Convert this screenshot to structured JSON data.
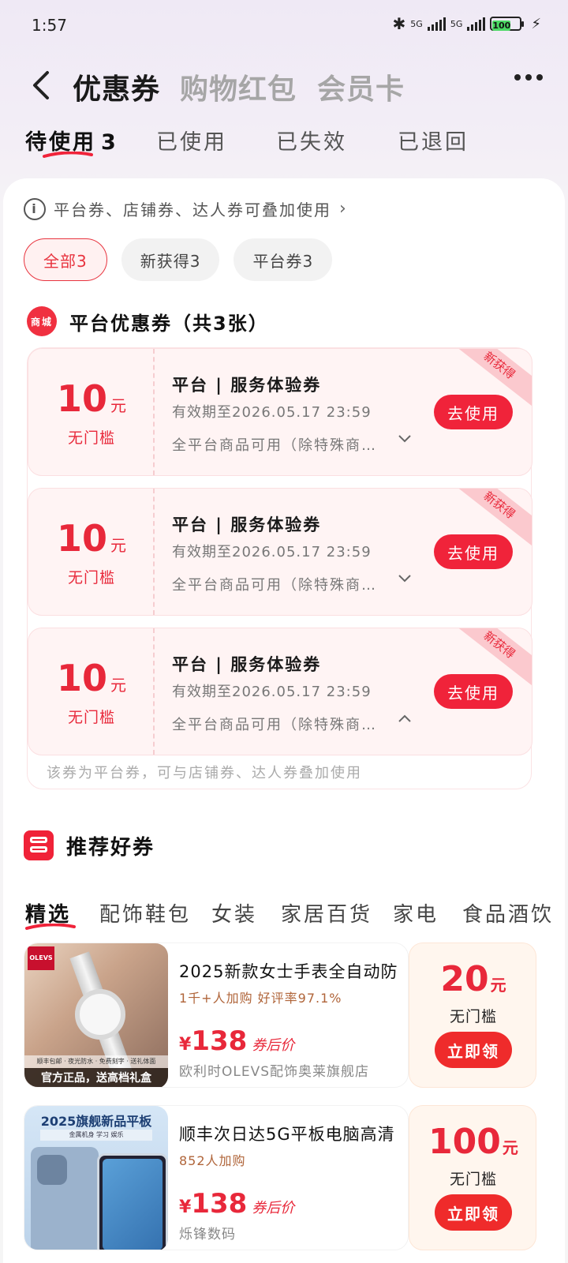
{
  "status_bar": {
    "time": "1:57",
    "network1": "5G",
    "network2": "5G",
    "battery": "100"
  },
  "header": {
    "tabs": [
      {
        "label": "优惠券",
        "active": true
      },
      {
        "label": "购物红包",
        "active": false
      },
      {
        "label": "会员卡",
        "active": false
      }
    ]
  },
  "status_tabs": [
    {
      "label": "待使用",
      "count": "3",
      "active": true
    },
    {
      "label": "已使用",
      "active": false
    },
    {
      "label": "已失效",
      "active": false
    },
    {
      "label": "已退回",
      "active": false
    }
  ],
  "tip": {
    "text": "平台券、店铺券、达人券可叠加使用"
  },
  "filters": [
    {
      "label": "全部3",
      "active": true
    },
    {
      "label": "新获得3",
      "active": false
    },
    {
      "label": "平台券3",
      "active": false
    }
  ],
  "section": {
    "icon_text": "商城",
    "title": "平台优惠券（共3张）"
  },
  "coupons": [
    {
      "amount": "10",
      "unit": "元",
      "condition": "无门槛",
      "name": "平台 | 服务体验券",
      "expiry": "有效期至2026.05.17 23:59",
      "scope": "全平台商品可用（除特殊商…",
      "toggle": "chevron-down",
      "button": "去使用",
      "ribbon": "新获得"
    },
    {
      "amount": "10",
      "unit": "元",
      "condition": "无门槛",
      "name": "平台 | 服务体验券",
      "expiry": "有效期至2026.05.17 23:59",
      "scope": "全平台商品可用（除特殊商…",
      "toggle": "chevron-down",
      "button": "去使用",
      "ribbon": "新获得"
    },
    {
      "amount": "10",
      "unit": "元",
      "condition": "无门槛",
      "name": "平台 | 服务体验券",
      "expiry": "有效期至2026.05.17 23:59",
      "scope": "全平台商品可用（除特殊商…",
      "toggle": "chevron-up",
      "button": "去使用",
      "ribbon": "新获得"
    }
  ],
  "group_note": "该券为平台券，可与店铺券、达人券叠加使用",
  "recommend": {
    "title": "推荐好券",
    "categories": [
      {
        "label": "精选",
        "active": true
      },
      {
        "label": "配饰鞋包",
        "active": false
      },
      {
        "label": "女装",
        "active": false
      },
      {
        "label": "家居百货",
        "active": false
      },
      {
        "label": "家电",
        "active": false
      },
      {
        "label": "食品酒饮",
        "active": false
      }
    ],
    "products": [
      {
        "title": "2025新款女士手表全自动防",
        "sales": "1千+人加购  好评率97.1%",
        "price_symbol": "¥",
        "price": "138",
        "price_note": "券后价",
        "shop": "欧利时OLEVS配饰奥莱旗舰店",
        "image_brand": "OLEVS",
        "image_sub": "顺丰包邮 · 夜光防水 · 免费刻字 · 送礼体面",
        "image_banner": "官方正品，送高档礼盒",
        "voucher_amount": "20",
        "voucher_unit": "元",
        "voucher_condition": "无门槛",
        "claim": "立即领"
      },
      {
        "title": "顺丰次日达5G平板电脑高清",
        "sales": "852人加购",
        "price_symbol": "¥",
        "price": "138",
        "price_note": "券后价",
        "shop": "烁锋数码",
        "image_top": "2025旗舰新品平板",
        "image_sub": "金属机身  学习  娱乐",
        "voucher_amount": "100",
        "voucher_unit": "元",
        "voucher_condition": "无门槛",
        "claim": "立即领"
      }
    ]
  },
  "colors": {
    "accent": "#f0233a",
    "coupon_bg": "#fff4f4"
  }
}
